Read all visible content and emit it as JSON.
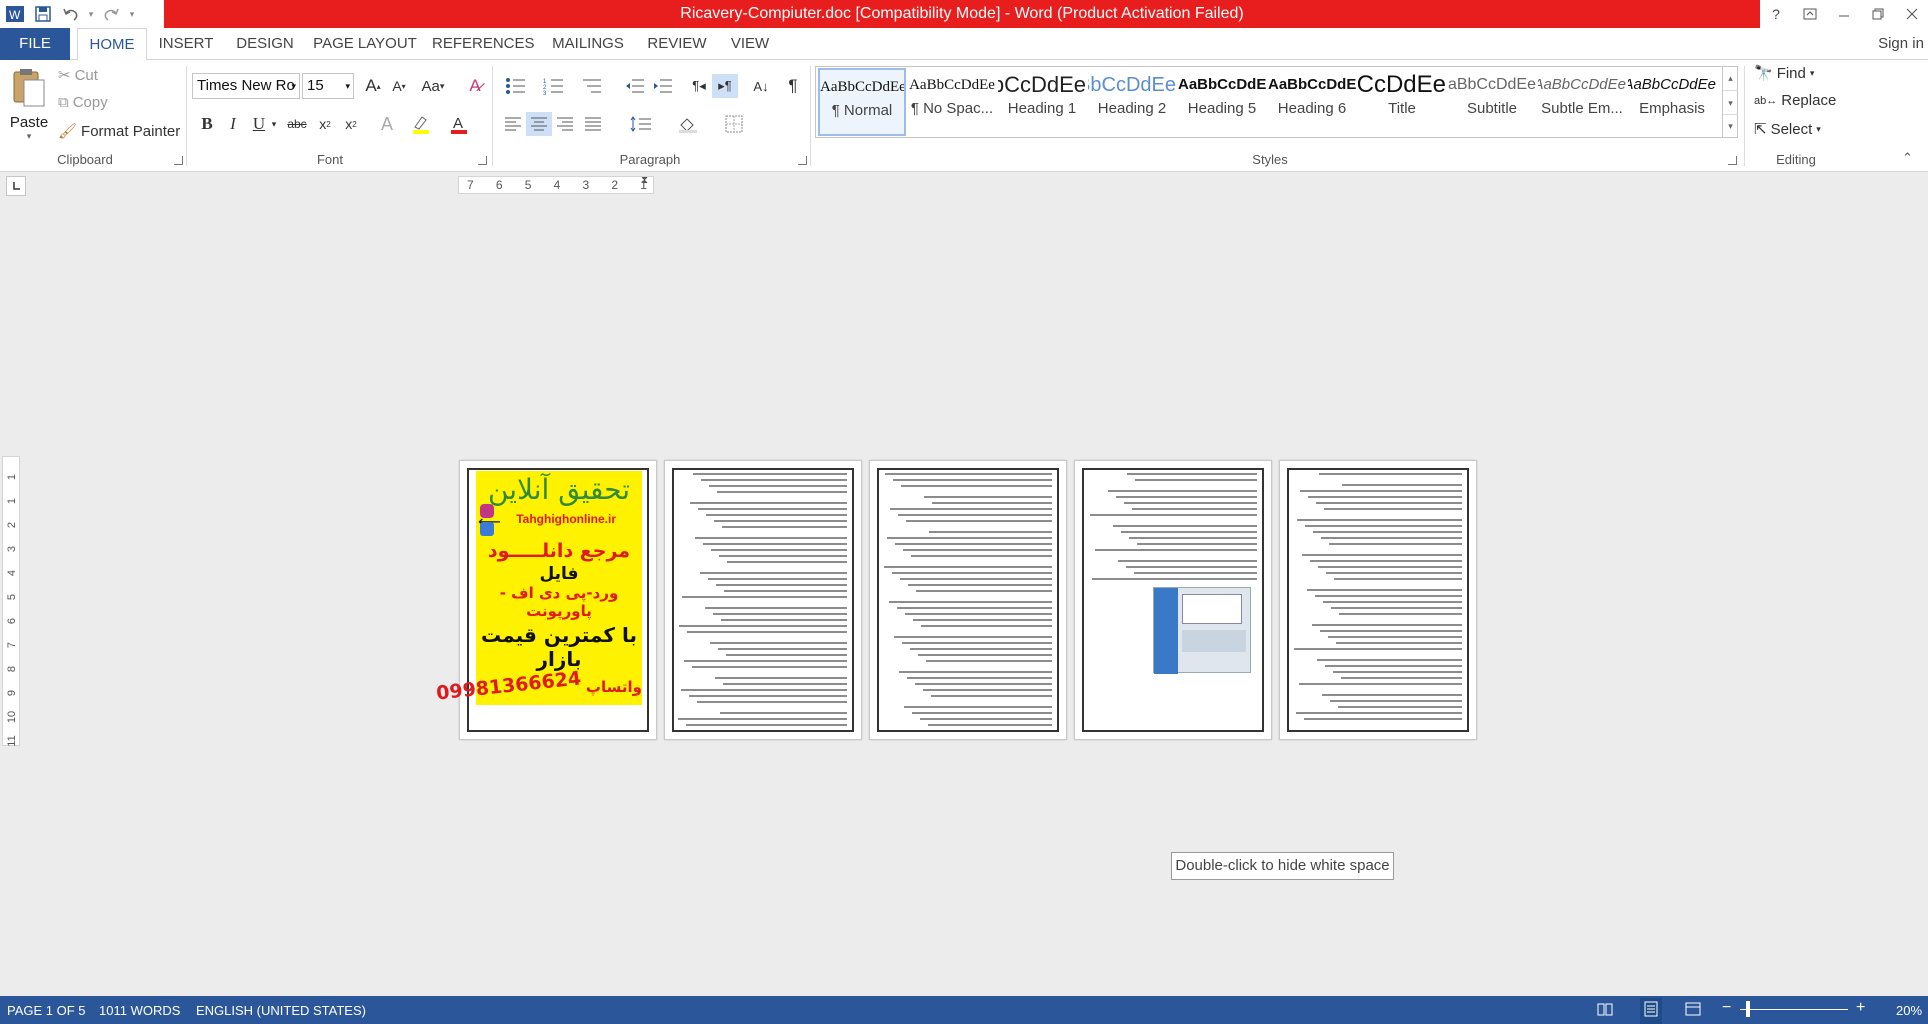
{
  "window": {
    "title": "Ricavery-Compiuter.doc [Compatibility Mode] -  Word (Product Activation Failed)",
    "help": "?",
    "sign_in": "Sign in"
  },
  "tabs": [
    "FILE",
    "HOME",
    "INSERT",
    "DESIGN",
    "PAGE LAYOUT",
    "REFERENCES",
    "MAILINGS",
    "REVIEW",
    "VIEW"
  ],
  "active_tab": "HOME",
  "clipboard": {
    "paste": "Paste",
    "cut": "Cut",
    "copy": "Copy",
    "format_painter": "Format Painter",
    "group_label": "Clipboard"
  },
  "font": {
    "name": "Times New Ro",
    "size": "15",
    "group_label": "Font",
    "aa": "Aa"
  },
  "paragraph": {
    "group_label": "Paragraph"
  },
  "styles": {
    "group_label": "Styles",
    "items": [
      {
        "preview": "AaBbCcDdEe",
        "name": "¶ Normal"
      },
      {
        "preview": "AaBbCcDdEe",
        "name": "¶ No Spac..."
      },
      {
        "preview": "AaBbCcDdEe",
        "name": "Heading 1"
      },
      {
        "preview": "AaBbCcDdEe",
        "name": "Heading 2"
      },
      {
        "preview": "AaBbCcDdEe",
        "name": "Heading 5"
      },
      {
        "preview": "AaBbCcDdEe",
        "name": "Heading 6"
      },
      {
        "preview": "AaBbCcDdEe",
        "name": "Title"
      },
      {
        "preview": "AaBbCcDdEe",
        "name": "Subtitle"
      },
      {
        "preview": "AaBbCcDdEe",
        "name": "Subtle Em..."
      },
      {
        "preview": "AaBbCcDdEe",
        "name": "Emphasis"
      }
    ]
  },
  "editing": {
    "find": "Find",
    "replace": "Replace",
    "select": "Select",
    "group_label": "Editing"
  },
  "ruler": {
    "h_numbers": [
      "7",
      "6",
      "5",
      "4",
      "3",
      "2",
      "1"
    ],
    "v_numbers": [
      "1",
      "1",
      "2",
      "3",
      "4",
      "5",
      "6",
      "7",
      "8",
      "9",
      "10",
      "11"
    ]
  },
  "page1_ad": {
    "heading": "تحقیق آنلاین",
    "site": "Tahghighonline.ir",
    "ref": "مرجع دانلـــــود",
    "file": "فایل",
    "formats": "ورد-پی دی اف - پاورپونت",
    "price": "با کمترین قیمت بازار",
    "phone": "09981366624",
    "whatsapp": "واتساپ"
  },
  "tooltip": "Double-click to hide white space",
  "status": {
    "page": "PAGE 1 OF 5",
    "words": "1011 WORDS",
    "language": "ENGLISH (UNITED STATES)",
    "zoom": "20%"
  },
  "colors": {
    "title_bar": "#e81d1d",
    "accent": "#2b579a",
    "ad_background": "#fff200",
    "ad_red": "#e01a1a"
  }
}
